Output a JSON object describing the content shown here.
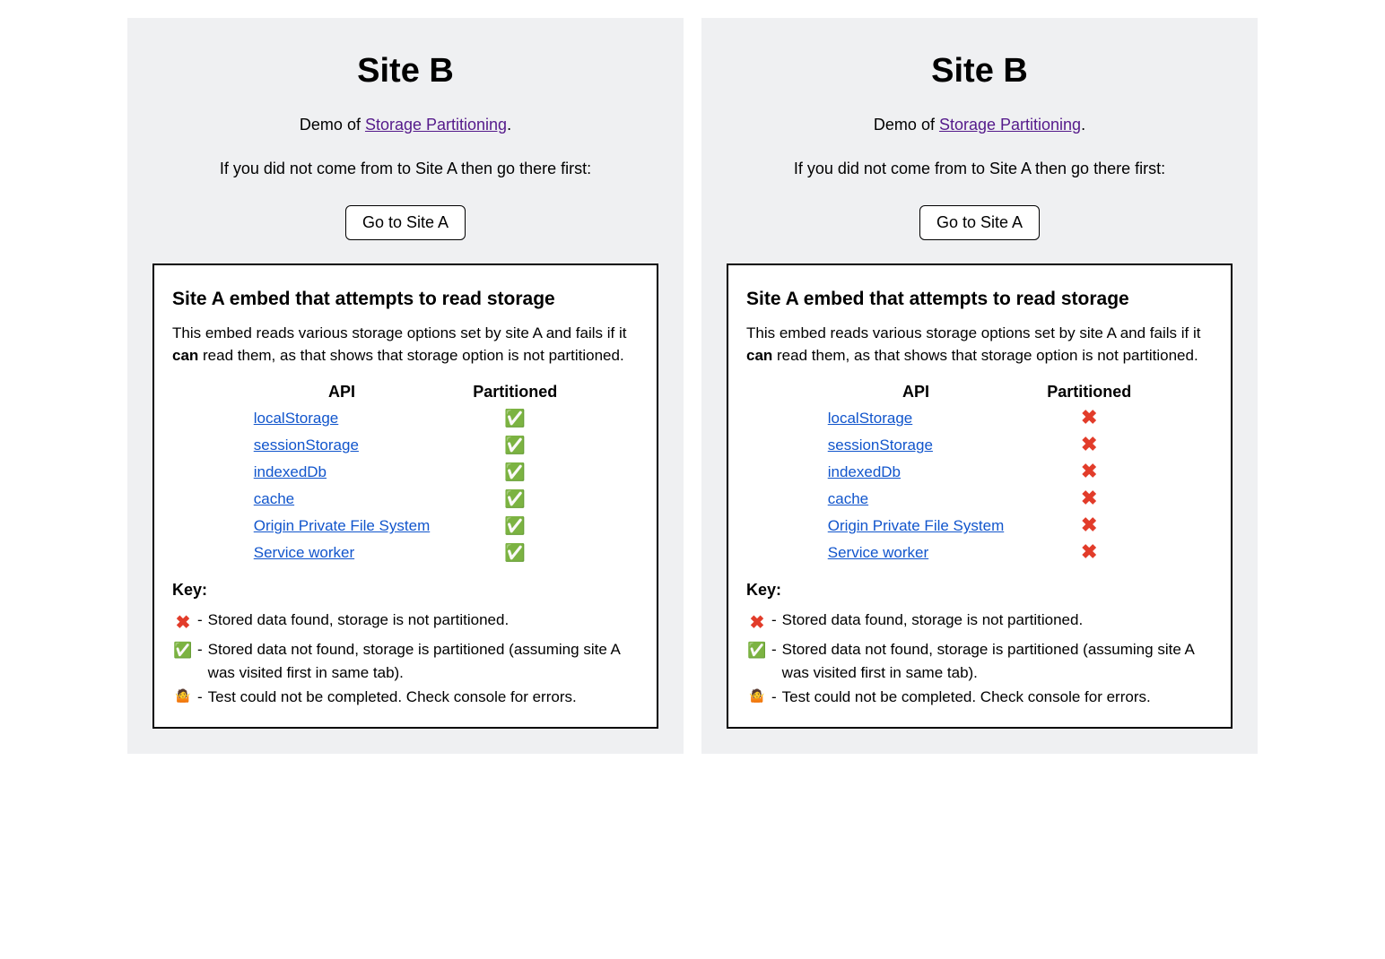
{
  "header": {
    "title": "Site B",
    "demo_prefix": "Demo of ",
    "demo_link": "Storage Partitioning",
    "demo_suffix": ".",
    "instruction": "If you did not come from to Site A then go there first:",
    "button_label": "Go to Site A"
  },
  "embed": {
    "title": "Site A embed that attempts to read storage",
    "desc_part1": "This embed reads various storage options set by site A and fails if it ",
    "desc_bold": "can",
    "desc_part2": " read them, as that shows that storage option is not partitioned.",
    "col_api": "API",
    "col_partitioned": "Partitioned"
  },
  "apis": [
    {
      "label": "localStorage"
    },
    {
      "label": "sessionStorage"
    },
    {
      "label": "indexedDb"
    },
    {
      "label": "cache"
    },
    {
      "label": "Origin Private File System"
    },
    {
      "label": "Service worker"
    }
  ],
  "panels": [
    {
      "statuses": [
        "pass",
        "pass",
        "pass",
        "pass",
        "pass",
        "pass"
      ]
    },
    {
      "statuses": [
        "fail",
        "fail",
        "fail",
        "fail",
        "fail",
        "fail"
      ]
    }
  ],
  "icons": {
    "pass": "✅",
    "fail": "❌",
    "unknown": "🤷"
  },
  "key": {
    "title": "Key:",
    "items": [
      {
        "icon": "fail",
        "text": "Stored data found, storage is not partitioned."
      },
      {
        "icon": "pass",
        "text": "Stored data not found, storage is partitioned (assuming site A was visited first in same tab)."
      },
      {
        "icon": "unknown",
        "text": "Test could not be completed. Check console for errors."
      }
    ]
  }
}
